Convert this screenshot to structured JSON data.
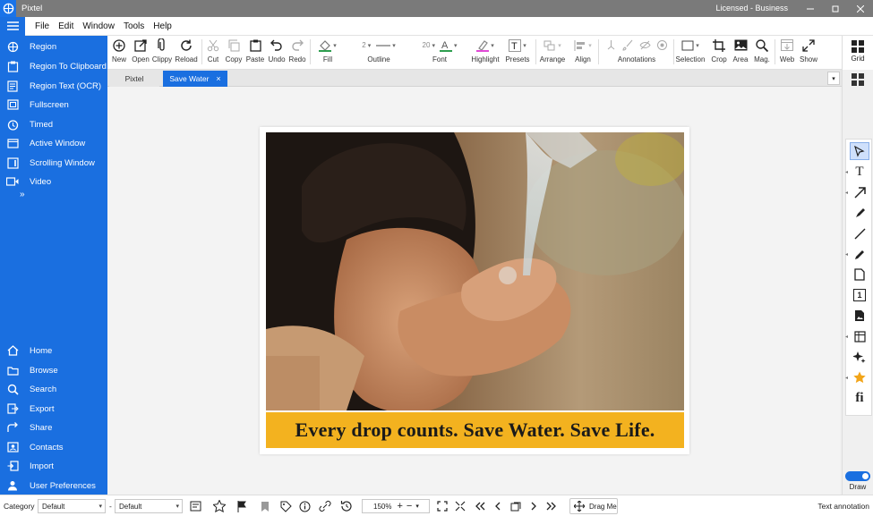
{
  "window": {
    "title": "Pixtel",
    "license": "Licensed - Business"
  },
  "menu": [
    "File",
    "Edit",
    "Window",
    "Tools",
    "Help"
  ],
  "sidebar": {
    "capture": [
      {
        "label": "Region",
        "icon": "crosshair-icon"
      },
      {
        "label": "Region To Clipboard",
        "icon": "clipboard-icon"
      },
      {
        "label": "Region Text (OCR)",
        "icon": "document-text-icon"
      },
      {
        "label": "Fullscreen",
        "icon": "fullscreen-icon"
      },
      {
        "label": "Timed",
        "icon": "timer-icon"
      },
      {
        "label": "Active Window",
        "icon": "window-icon"
      },
      {
        "label": "Scrolling Window",
        "icon": "scroll-window-icon"
      },
      {
        "label": "Video",
        "icon": "video-icon"
      }
    ],
    "more": "»",
    "bottom": [
      {
        "label": "Home",
        "icon": "home-icon"
      },
      {
        "label": "Browse",
        "icon": "folder-icon"
      },
      {
        "label": "Search",
        "icon": "search-icon"
      },
      {
        "label": "Export",
        "icon": "export-icon"
      },
      {
        "label": "Share",
        "icon": "share-icon"
      },
      {
        "label": "Contacts",
        "icon": "contacts-icon"
      },
      {
        "label": "Import",
        "icon": "import-icon"
      },
      {
        "label": "User Preferences",
        "icon": "user-icon"
      }
    ]
  },
  "toolbar": {
    "new": "New",
    "open": "Open",
    "clippy": "Clippy",
    "reload": "Reload",
    "cut": "Cut",
    "copy": "Copy",
    "paste": "Paste",
    "undo": "Undo",
    "redo": "Redo",
    "fill": "Fill",
    "outline": "Outline",
    "outline_width": "2",
    "font": "Font",
    "font_size": "20",
    "highlight": "Highlight",
    "presets": "Presets",
    "arrange": "Arrange",
    "align": "Align",
    "annotations": "Annotations",
    "selection": "Selection",
    "crop": "Crop",
    "area": "Area",
    "mag": "Mag.",
    "web": "Web",
    "show": "Show",
    "grid": "Grid"
  },
  "tabs": {
    "home_tab": "Pixtel",
    "active_tab": "Save Water",
    "close_glyph": "×",
    "dropdown_glyph": "▾"
  },
  "image": {
    "caption": "Every drop counts. Save Water. Save Life."
  },
  "tools_panel": {
    "text_tool": "T",
    "fi_tool": "fi",
    "counter_tool": "1",
    "draw_label": "Draw"
  },
  "statusbar": {
    "category_label": "Category",
    "category_value": "Default",
    "separator": "-",
    "preset_value": "Default",
    "zoom": "150%",
    "drag_me": "Drag Me",
    "mode": "Text annotation"
  },
  "colors": {
    "accent": "#1a6fe0",
    "banner": "#f3b21f",
    "fill_swatch": "#2e9e4f",
    "highlight_swatch": "#e04ad6"
  }
}
